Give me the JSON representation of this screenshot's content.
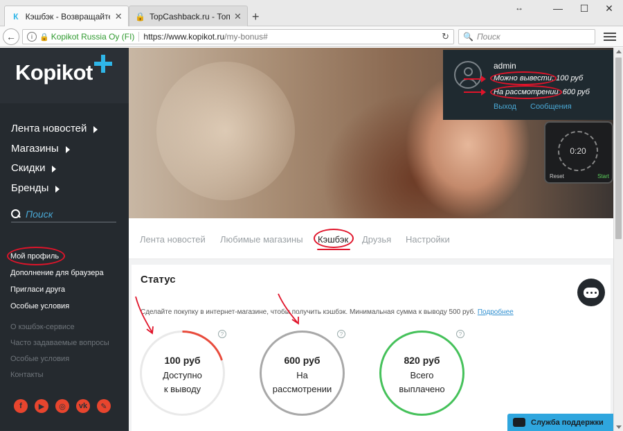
{
  "browser": {
    "tabs": [
      {
        "title": "Кэшбэк - Возвращайте д...",
        "favicon": "К",
        "favicon_color": "#2fb6e8"
      },
      {
        "title": "TopCashback.ru - Топ лу...",
        "favicon": "T",
        "favicon_color": "#f2b318"
      }
    ],
    "url_org": "Kopikot Russia Oy (FI)",
    "url_host": "https://www.kopikot.ru",
    "url_path": "/my-bonus#",
    "search_placeholder": "Поиск"
  },
  "sidebar": {
    "logo": "Kopikot",
    "menu": [
      "Лента новостей",
      "Магазины",
      "Скидки",
      "Бренды"
    ],
    "search_placeholder": "Поиск",
    "profile_items": [
      "Мой профиль",
      "Дополнение для браузера",
      "Пригласи друга",
      "Особые условия"
    ],
    "info_items": [
      "О кэшбэк-сервисе",
      "Часто задаваемые вопросы",
      "Особые условия",
      "Контакты"
    ],
    "socials": [
      "facebook-icon",
      "youtube-icon",
      "instagram-icon",
      "vk-icon",
      "pencil-icon"
    ],
    "accent": "#2fb6e8"
  },
  "hero": {
    "watch_time": "0:20",
    "watch_buttons": [
      "Reset",
      "Start"
    ]
  },
  "user": {
    "name": "admin",
    "withdraw_label": "Можно вывести:",
    "withdraw_value": "100 руб",
    "review_label": "На рассмотрении:",
    "review_value": "600 руб",
    "logout": "Выход",
    "messages": "Сообщения"
  },
  "tabs": [
    "Лента новостей",
    "Любимые магазины",
    "Кэшбэк",
    "Друзья",
    "Настройки"
  ],
  "status": {
    "title": "Статус",
    "description": "Сделайте покупку в интернет-магазине, чтобы получить кэшбэк. Минимальная сумма к выводу 500 руб.",
    "more_link": "Подробнее",
    "rings": [
      {
        "value": "100 руб",
        "line1": "Доступно",
        "line2": "к выводу",
        "color": "#e84b3c",
        "fraction": 0.2
      },
      {
        "value": "600 руб",
        "line1": "На",
        "line2": "рассмотрении",
        "color": "#a8a8a8",
        "fraction": 1
      },
      {
        "value": "820 руб",
        "line1": "Всего",
        "line2": "выплачено",
        "color": "#45c15a",
        "fraction": 1
      }
    ]
  },
  "support": "Служба поддержки"
}
